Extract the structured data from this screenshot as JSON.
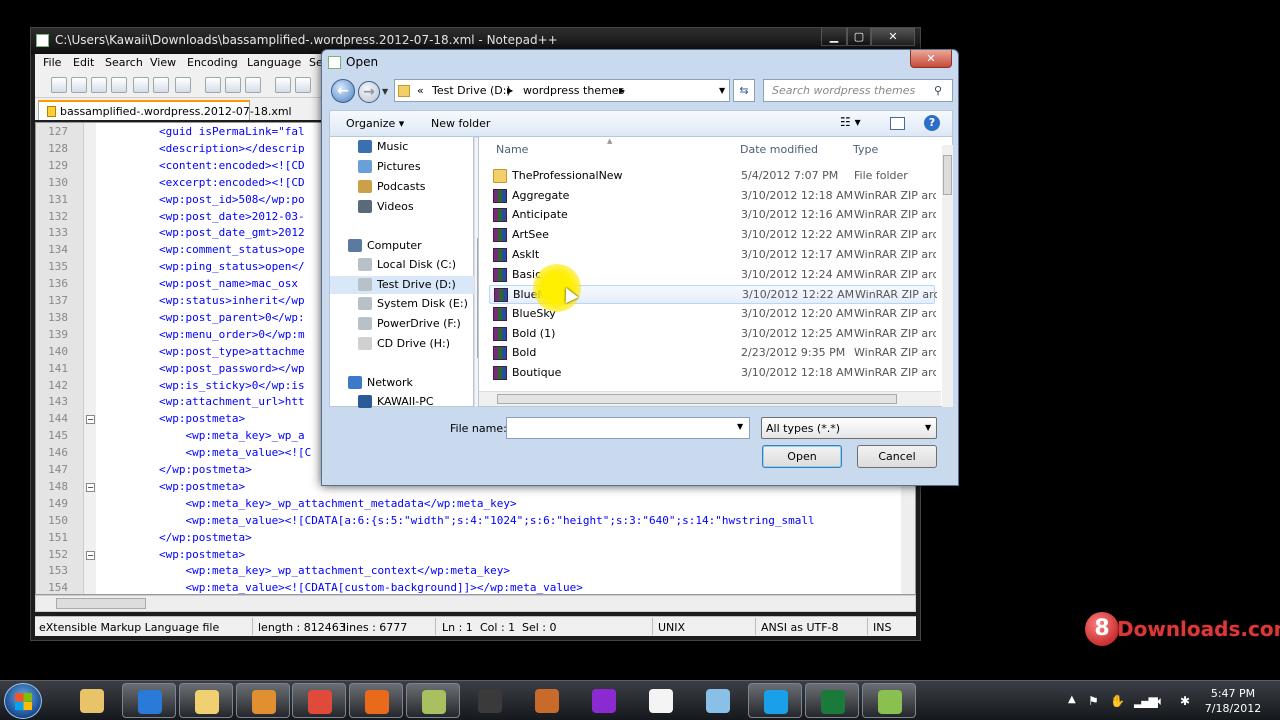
{
  "notepad": {
    "title": "C:\\Users\\Kawaii\\Downloads\\bassamplified-.wordpress.2012-07-18.xml - Notepad++",
    "menu": [
      "File",
      "Edit",
      "Search",
      "View",
      "Encoding",
      "Language",
      "Se"
    ],
    "tab_label": "bassamplified-.wordpress.2012-07-18.xml",
    "lines": [
      {
        "n": "127",
        "code": "        <guid isPermaLink=\"fal"
      },
      {
        "n": "128",
        "code": "        <description></descrip"
      },
      {
        "n": "129",
        "code": "        <content:encoded><![CD"
      },
      {
        "n": "130",
        "code": "        <excerpt:encoded><![CD"
      },
      {
        "n": "131",
        "code": "        <wp:post_id>508</wp:po"
      },
      {
        "n": "132",
        "code": "        <wp:post_date>2012-03-"
      },
      {
        "n": "133",
        "code": "        <wp:post_date_gmt>2012"
      },
      {
        "n": "134",
        "code": "        <wp:comment_status>ope"
      },
      {
        "n": "135",
        "code": "        <wp:ping_status>open</"
      },
      {
        "n": "136",
        "code": "        <wp:post_name>mac_osx "
      },
      {
        "n": "137",
        "code": "        <wp:status>inherit</wp"
      },
      {
        "n": "138",
        "code": "        <wp:post_parent>0</wp:"
      },
      {
        "n": "139",
        "code": "        <wp:menu_order>0</wp:m"
      },
      {
        "n": "140",
        "code": "        <wp:post_type>attachme"
      },
      {
        "n": "141",
        "code": "        <wp:post_password></wp"
      },
      {
        "n": "142",
        "code": "        <wp:is_sticky>0</wp:is"
      },
      {
        "n": "143",
        "code": "        <wp:attachment_url>htt"
      },
      {
        "n": "144",
        "code": "        <wp:postmeta>"
      },
      {
        "n": "145",
        "code": "            <wp:meta_key>_wp_a"
      },
      {
        "n": "146",
        "code": "            <wp:meta_value><![C"
      },
      {
        "n": "147",
        "code": "        </wp:postmeta>"
      },
      {
        "n": "148",
        "code": "        <wp:postmeta>"
      },
      {
        "n": "149",
        "code": "            <wp:meta_key>_wp_attachment_metadata</wp:meta_key>"
      },
      {
        "n": "150",
        "code": "            <wp:meta_value><![CDATA[a:6:{s:5:\"width\";s:4:\"1024\";s:6:\"height\";s:3:\"640\";s:14:\"hwstring_small"
      },
      {
        "n": "151",
        "code": "        </wp:postmeta>"
      },
      {
        "n": "152",
        "code": "        <wp:postmeta>"
      },
      {
        "n": "153",
        "code": "            <wp:meta_key>_wp_attachment_context</wp:meta_key>"
      },
      {
        "n": "154",
        "code": "            <wp:meta_value><![CDATA[custom-background]]></wp:meta_value>"
      }
    ],
    "status": {
      "filetype": "eXtensible Markup Language file",
      "length": "length : 812463",
      "lines": "lines : 6777",
      "ln": "Ln : 1",
      "col": "Col : 1",
      "sel": "Sel : 0",
      "eol": "UNIX",
      "encoding": "ANSI as UTF-8",
      "mode": "INS"
    }
  },
  "dialog": {
    "title": "Open",
    "close": "✕",
    "breadcrumb": [
      "«",
      "Test Drive (D:)",
      "wordpress themes"
    ],
    "search_placeholder": "Search wordpress themes",
    "organize": "Organize ▾",
    "new_folder": "New folder",
    "nav": [
      {
        "label": "Music",
        "kind": "music"
      },
      {
        "label": "Pictures",
        "kind": "pictures"
      },
      {
        "label": "Podcasts",
        "kind": "podcasts"
      },
      {
        "label": "Videos",
        "kind": "videos"
      },
      {
        "label": "Computer",
        "kind": "computer"
      },
      {
        "label": "Local Disk (C:)",
        "kind": "drive"
      },
      {
        "label": "Test Drive (D:)",
        "kind": "drive"
      },
      {
        "label": "System Disk (E:)",
        "kind": "drive"
      },
      {
        "label": "PowerDrive (F:)",
        "kind": "drive"
      },
      {
        "label": "CD Drive (H:)",
        "kind": "cd"
      },
      {
        "label": "Network",
        "kind": "network"
      },
      {
        "label": "KAWAII-PC",
        "kind": "pc"
      }
    ],
    "columns": {
      "name": "Name",
      "date": "Date modified",
      "type": "Type"
    },
    "files": [
      {
        "name": "TheProfessionalNew",
        "date": "5/4/2012 7:07 PM",
        "type": "File folder",
        "icon": "folder-icon"
      },
      {
        "name": "Aggregate",
        "date": "3/10/2012 12:18 AM",
        "type": "WinRAR ZIP archi",
        "icon": "rar-icon"
      },
      {
        "name": "Anticipate",
        "date": "3/10/2012 12:16 AM",
        "type": "WinRAR ZIP archi",
        "icon": "rar-icon"
      },
      {
        "name": "ArtSee",
        "date": "3/10/2012 12:22 AM",
        "type": "WinRAR ZIP archi",
        "icon": "rar-icon"
      },
      {
        "name": "AskIt",
        "date": "3/10/2012 12:17 AM",
        "type": "WinRAR ZIP archi",
        "icon": "rar-icon"
      },
      {
        "name": "Basic",
        "date": "3/10/2012 12:24 AM",
        "type": "WinRAR ZIP archi",
        "icon": "rar-icon"
      },
      {
        "name": "BlueMist",
        "date": "3/10/2012 12:22 AM",
        "type": "WinRAR ZIP archi",
        "icon": "rar-icon"
      },
      {
        "name": "BlueSky",
        "date": "3/10/2012 12:20 AM",
        "type": "WinRAR ZIP archi",
        "icon": "rar-icon"
      },
      {
        "name": "Bold (1)",
        "date": "3/10/2012 12:25 AM",
        "type": "WinRAR ZIP archi",
        "icon": "rar-icon"
      },
      {
        "name": "Bold",
        "date": "2/23/2012 9:35 PM",
        "type": "WinRAR ZIP archi",
        "icon": "rar-icon"
      },
      {
        "name": "Boutique",
        "date": "3/10/2012 12:18 AM",
        "type": "WinRAR ZIP archi",
        "icon": "rar-icon"
      }
    ],
    "file_name_label": "File name:",
    "file_name_value": "",
    "file_type": "All types (*.*)",
    "open_button": "Open",
    "cancel_button": "Cancel"
  },
  "watermark": {
    "digit": "8",
    "text": "Downloads.com"
  },
  "taskbar": {
    "time": "5:47 PM",
    "date": "7/18/2012",
    "apps": [
      "explorer",
      "ie",
      "file-manager",
      "media-player",
      "chrome",
      "firefox",
      "notes",
      "winamp",
      "tools",
      "torrent",
      "notebook",
      "sticky",
      "skype",
      "excel",
      "notepad++"
    ]
  }
}
